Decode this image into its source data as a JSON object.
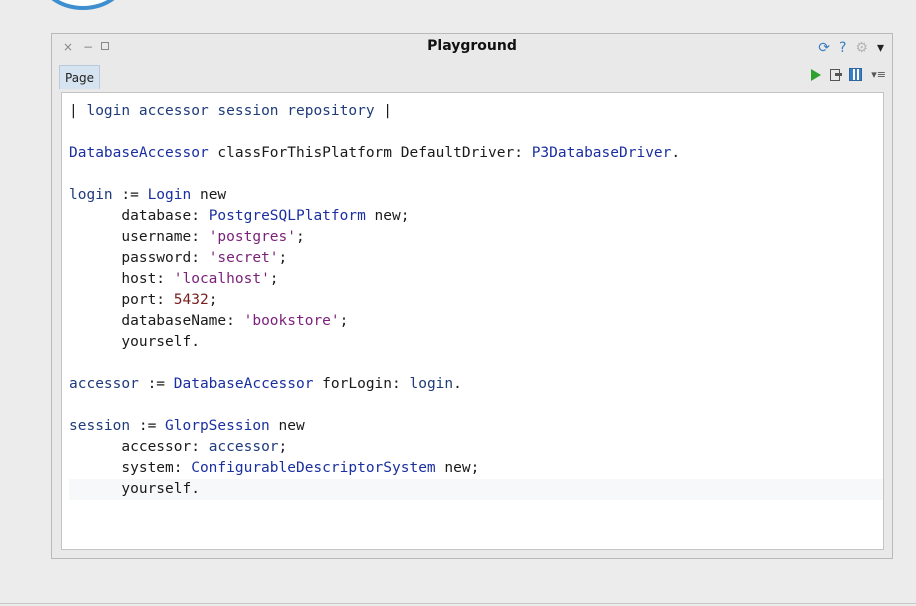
{
  "window": {
    "title": "Playground",
    "controls": {
      "close": "×",
      "minimize": "−"
    },
    "title_icons": [
      {
        "name": "sync-icon",
        "glyph": "⟳",
        "color": "#3a7fc1"
      },
      {
        "name": "help-icon",
        "glyph": "?",
        "color": "#3a7fc1"
      },
      {
        "name": "gear-icon",
        "glyph": "⚙",
        "color": "#b5b5b5"
      },
      {
        "name": "dropdown-arrow-icon",
        "glyph": "▾",
        "color": "#222222"
      }
    ]
  },
  "tab": {
    "label": "Page"
  },
  "toolbar": {
    "icons": [
      "play-icon",
      "export-icon",
      "grid-icon",
      "menu-icon"
    ],
    "menu_glyph": "▾≡"
  },
  "colors": {
    "accent": "#3a7fc1",
    "play": "#2fa12f",
    "variable": "#1f3b7a",
    "class": "#1a2fa0",
    "string": "#7a1f7a",
    "number": "#7a1f1f"
  },
  "code_lines": [
    [
      [
        "plain",
        "| "
      ],
      [
        "var",
        "login accessor session repository"
      ],
      [
        "plain",
        " |"
      ]
    ],
    [],
    [
      [
        "cls",
        "DatabaseAccessor"
      ],
      [
        "plain",
        " classForThisPlatform DefaultDriver: "
      ],
      [
        "cls",
        "P3DatabaseDriver"
      ],
      [
        "plain",
        "."
      ]
    ],
    [],
    [
      [
        "var",
        "login"
      ],
      [
        "plain",
        " := "
      ],
      [
        "cls",
        "Login"
      ],
      [
        "plain",
        " new"
      ]
    ],
    [
      [
        "plain",
        "      database: "
      ],
      [
        "cls",
        "PostgreSQLPlatform"
      ],
      [
        "plain",
        " new;"
      ]
    ],
    [
      [
        "plain",
        "      username: "
      ],
      [
        "str",
        "'postgres'"
      ],
      [
        "plain",
        ";"
      ]
    ],
    [
      [
        "plain",
        "      password: "
      ],
      [
        "str",
        "'secret'"
      ],
      [
        "plain",
        ";"
      ]
    ],
    [
      [
        "plain",
        "      host: "
      ],
      [
        "str",
        "'localhost'"
      ],
      [
        "plain",
        ";"
      ]
    ],
    [
      [
        "plain",
        "      port: "
      ],
      [
        "num",
        "5432"
      ],
      [
        "plain",
        ";"
      ]
    ],
    [
      [
        "plain",
        "      databaseName: "
      ],
      [
        "str",
        "'bookstore'"
      ],
      [
        "plain",
        ";"
      ]
    ],
    [
      [
        "plain",
        "      yourself."
      ]
    ],
    [],
    [
      [
        "var",
        "accessor"
      ],
      [
        "plain",
        " := "
      ],
      [
        "cls",
        "DatabaseAccessor"
      ],
      [
        "plain",
        " forLogin: "
      ],
      [
        "var",
        "login"
      ],
      [
        "plain",
        "."
      ]
    ],
    [],
    [
      [
        "var",
        "session"
      ],
      [
        "plain",
        " := "
      ],
      [
        "cls",
        "GlorpSession"
      ],
      [
        "plain",
        " new"
      ]
    ],
    [
      [
        "plain",
        "      accessor: "
      ],
      [
        "var",
        "accessor"
      ],
      [
        "plain",
        ";"
      ]
    ],
    [
      [
        "plain",
        "      system: "
      ],
      [
        "cls",
        "ConfigurableDescriptorSystem"
      ],
      [
        "plain",
        " new;"
      ]
    ],
    [
      [
        "plain",
        "      yourself."
      ]
    ]
  ],
  "current_line": 18
}
